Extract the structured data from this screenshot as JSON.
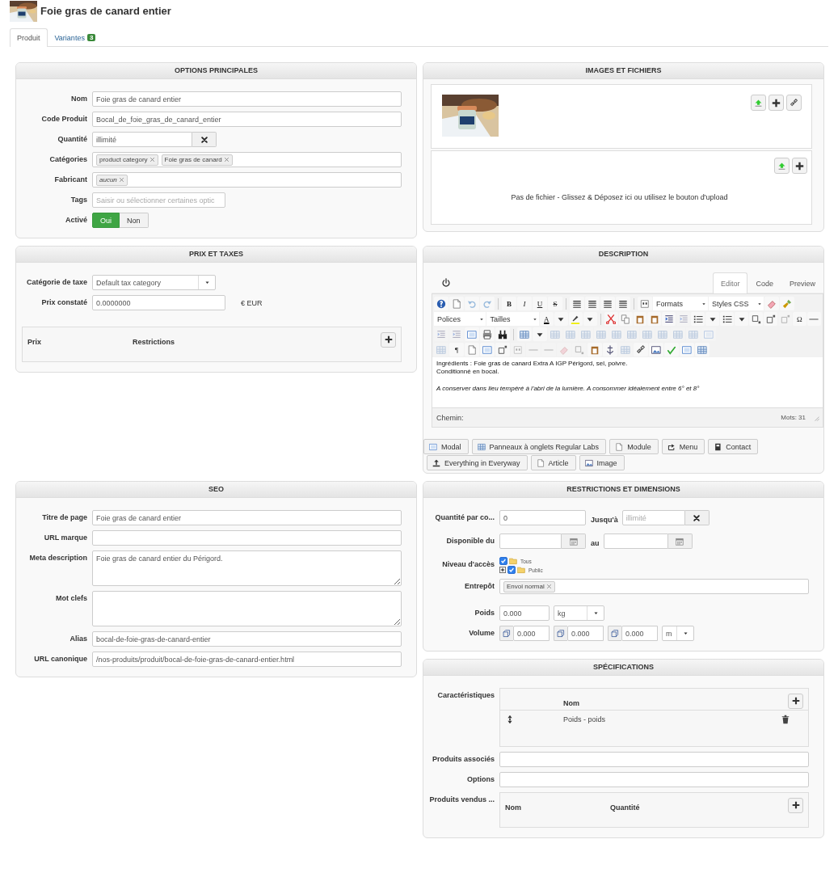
{
  "header": {
    "title": "Foie gras de canard entier"
  },
  "tabs": [
    {
      "label": "Produit",
      "selected": true
    },
    {
      "label": "Variantes",
      "badge": "3",
      "selected": false
    }
  ],
  "panel_rows": [
    {
      "left": [
        {
          "kind": "form",
          "title": "OPTIONS PRINCIPALES",
          "rows": [
            {
              "kind": "text",
              "label": "Nom",
              "value": "Foie gras de canard entier"
            },
            {
              "kind": "text",
              "label": "Code Produit",
              "value": "Bocal_de_foie_gras_de_canard_entier"
            },
            {
              "kind": "clearable",
              "label": "Quantité",
              "value": "illimité"
            },
            {
              "kind": "tags",
              "label": "Catégories",
              "tags": [
                {
                  "text": "product category",
                  "italic": false
                },
                {
                  "text": "Foie gras de canard",
                  "italic": false
                }
              ]
            },
            {
              "kind": "tags",
              "label": "Fabricant",
              "tags": [
                {
                  "text": "aucun",
                  "italic": true
                }
              ]
            },
            {
              "kind": "short_text",
              "label": "Tags",
              "placeholder": "Saisir ou sélectionner certaines optic"
            },
            {
              "kind": "toggle",
              "label": "Activé",
              "options": [
                {
                  "label": "Oui",
                  "selected": true
                },
                {
                  "label": "Non",
                  "selected": false
                }
              ]
            }
          ]
        }
      ],
      "right": [
        {
          "kind": "files",
          "title": "IMAGES ET FICHIERS",
          "sections": [
            {
              "kind": "images"
            },
            {
              "kind": "files",
              "empty_text": "Pas de fichier - Glissez & Déposez ici ou utilisez le bouton d'upload"
            }
          ]
        }
      ]
    },
    {
      "left": [
        {
          "kind": "form",
          "title": "PRIX ET TAXES",
          "rows": [
            {
              "kind": "select",
              "label": "Catégorie de taxe",
              "value": "Default tax category"
            },
            {
              "kind": "short_text",
              "label": "Prix constaté",
              "value": "0.0000000",
              "suffix": "€ EUR"
            },
            {
              "kind": "table",
              "columns": [
                "Prix",
                "Restrictions"
              ]
            }
          ]
        }
      ],
      "right": [
        {
          "kind": "editor",
          "title": "DESCRIPTION",
          "tabs": [
            {
              "label": "Editor",
              "selected": true
            },
            {
              "label": "Code",
              "selected": false
            },
            {
              "label": "Preview",
              "selected": false
            }
          ],
          "toolbar": {
            "dropdowns": [
              "Formats",
              "Styles CSS",
              "Polices",
              "Tailles"
            ],
            "glyphs": [
              "B",
              "I",
              "U",
              "S",
              "A",
              "Ω",
              "¶"
            ]
          },
          "content": [
            {
              "lines": [
                "Ingrédients : Foie gras de canard Extra A IGP Périgord, sel, poivre.",
                "Conditionné en bocal."
              ],
              "italic": false
            },
            {
              "lines": [
                "A conserver dans lieu tempéré à l'abri de la lumière. A consommer idéalement entre 6° et 8°"
              ],
              "italic": true
            }
          ],
          "path_label": "Chemin:",
          "word_count": "Mots: 31",
          "buttons": [
            [
              "Modal",
              "Panneaux à onglets Regular Labs",
              "Module",
              "Menu",
              "Contact"
            ],
            [
              "Everything in Everyway",
              "Article",
              "Image"
            ]
          ]
        }
      ]
    },
    {
      "left": [
        {
          "kind": "form",
          "title": "SEO",
          "rows": [
            {
              "kind": "text",
              "label": "Titre de page",
              "value": "Foie gras de canard entier"
            },
            {
              "kind": "text",
              "label": "URL marque"
            },
            {
              "kind": "textarea",
              "label": "Meta description",
              "value": "Foie gras de canard entier du Périgord."
            },
            {
              "kind": "textarea",
              "label": "Mot clefs"
            },
            {
              "kind": "text",
              "label": "Alias",
              "value": "bocal-de-foie-gras-de-canard-entier"
            },
            {
              "kind": "text",
              "label": "URL canonique",
              "value": "/nos-produits/produit/bocal-de-foie-gras-de-canard-entier.html"
            }
          ]
        }
      ],
      "right": [
        {
          "kind": "form",
          "title": "RESTRICTIONS ET DIMENSIONS",
          "rows": [
            {
              "kind": "range",
              "label": "Quantité par co...",
              "value": "0",
              "between": "Jusqu'à",
              "placeholder": "illimité"
            },
            {
              "kind": "date_range",
              "label": "Disponible du",
              "between": "au"
            },
            {
              "kind": "tree",
              "label": "Niveau d'accès",
              "nodes": [
                {
                  "label": "Tous",
                  "checked": true,
                  "children": [
                    {
                      "label": "Public",
                      "checked": true,
                      "expanded": false
                    }
                  ]
                }
              ]
            },
            {
              "kind": "tags",
              "label": "Entrepôt",
              "tags": [
                {
                  "text": "Envoi normal",
                  "italic": false
                }
              ]
            },
            {
              "kind": "unit",
              "label": "Poids",
              "value": "0.000",
              "unit": "kg"
            },
            {
              "kind": "volume",
              "label": "Volume",
              "values": [
                "0.000",
                "0.000",
                "0.000"
              ],
              "unit": "m"
            }
          ]
        },
        {
          "kind": "form",
          "title": "SPÉCIFICATIONS",
          "rows": [
            {
              "kind": "table",
              "label": "Caractéristiques",
              "columns": [
                "Nom"
              ],
              "rows": [
                [
                  "Poids - poids"
                ]
              ]
            },
            {
              "kind": "text",
              "label": "Produits associés"
            },
            {
              "kind": "text",
              "label": "Options"
            },
            {
              "kind": "table",
              "label": "Produits vendus ...",
              "columns": [
                "Nom",
                "Quantité"
              ]
            }
          ]
        }
      ]
    }
  ]
}
